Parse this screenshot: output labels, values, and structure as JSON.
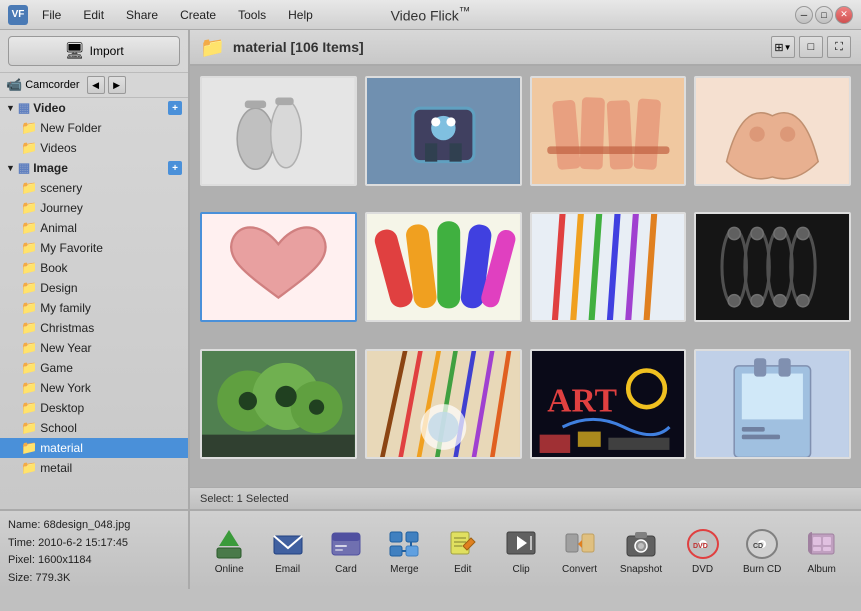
{
  "app": {
    "title": "Video Flick",
    "title_tm": "™",
    "icon_label": "VF"
  },
  "menu": {
    "items": [
      "File",
      "Edit",
      "Share",
      "Create",
      "Tools",
      "Help"
    ]
  },
  "sidebar": {
    "import_label": "Import",
    "nav_label": "Camcorder",
    "sections": [
      {
        "label": "Video",
        "expanded": true,
        "children": [
          "New Folder",
          "Videos"
        ]
      },
      {
        "label": "Image",
        "expanded": true,
        "children": [
          "scenery",
          "Journey",
          "Animal",
          "My Favorite",
          "Book",
          "Design",
          "My family",
          "Christmas",
          "New Year",
          "Game",
          "New York",
          "Desktop",
          "School",
          "material",
          "metail"
        ]
      }
    ]
  },
  "content": {
    "folder_label": "material [106 Items]",
    "status": "Select:  1 Selected",
    "thumbnails": [
      {
        "id": 1,
        "class": "thumb-1",
        "type": "bottles"
      },
      {
        "id": 2,
        "class": "thumb-2",
        "type": "robot"
      },
      {
        "id": 3,
        "class": "thumb-3",
        "type": "hands-thumbs"
      },
      {
        "id": 4,
        "class": "thumb-4",
        "type": "hands-cup"
      },
      {
        "id": 5,
        "class": "thumb-5",
        "type": "heart-hands",
        "selected": true
      },
      {
        "id": 6,
        "class": "thumb-6",
        "type": "colorful-hands"
      },
      {
        "id": 7,
        "class": "thumb-7",
        "type": "pencils-colorful"
      },
      {
        "id": 8,
        "class": "thumb-8",
        "type": "chains"
      },
      {
        "id": 9,
        "class": "thumb-9",
        "type": "apples"
      },
      {
        "id": 10,
        "class": "thumb-10",
        "type": "pencils-arrange"
      },
      {
        "id": 11,
        "class": "thumb-11",
        "type": "art-dark"
      },
      {
        "id": 12,
        "class": "thumb-12",
        "type": "bag"
      }
    ]
  },
  "file_info": {
    "name": "Name: 68design_048.jpg",
    "time": "Time: 2010-6-2 15:17:45",
    "pixel": "Pixel: 1600x1184",
    "size": "Size: 779.3K"
  },
  "toolbar": {
    "tools": [
      {
        "id": "online",
        "label": "Online",
        "icon": "↑"
      },
      {
        "id": "email",
        "label": "Email",
        "icon": "✉"
      },
      {
        "id": "card",
        "label": "Card",
        "icon": "▦"
      },
      {
        "id": "merge",
        "label": "Merge",
        "icon": "⊞"
      },
      {
        "id": "edit",
        "label": "Edit",
        "icon": "✏"
      },
      {
        "id": "clip",
        "label": "Clip",
        "icon": "✂"
      },
      {
        "id": "convert",
        "label": "Convert",
        "icon": "⇒"
      },
      {
        "id": "snapshot",
        "label": "Snapshot",
        "icon": "📷"
      },
      {
        "id": "dvd",
        "label": "DVD",
        "icon": "💿"
      },
      {
        "id": "cd",
        "label": "Burn CD",
        "icon": "💿"
      },
      {
        "id": "burn",
        "label": "Burn CD",
        "icon": "💿"
      },
      {
        "id": "album",
        "label": "Album",
        "icon": "🔗"
      }
    ]
  }
}
